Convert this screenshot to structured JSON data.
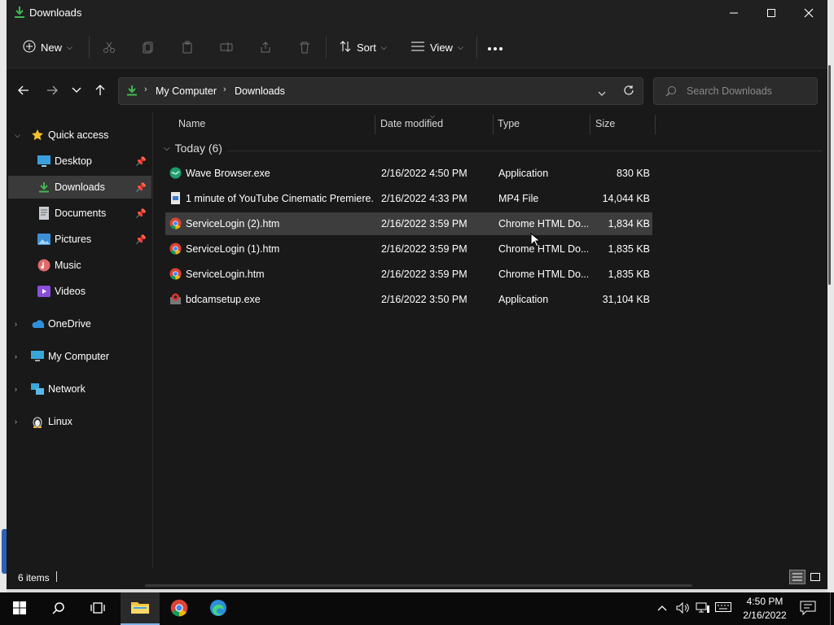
{
  "window": {
    "title": "Downloads"
  },
  "toolbar": {
    "new_label": "New",
    "sort_label": "Sort",
    "view_label": "View"
  },
  "address": {
    "crumbs": [
      "My Computer",
      "Downloads"
    ],
    "search_placeholder": "Search Downloads"
  },
  "nav": {
    "quick_access": "Quick access",
    "pinned": [
      {
        "label": "Desktop",
        "icon": "desktop-icon"
      },
      {
        "label": "Downloads",
        "icon": "downloads-icon"
      },
      {
        "label": "Documents",
        "icon": "documents-icon"
      },
      {
        "label": "Pictures",
        "icon": "pictures-icon"
      }
    ],
    "other": [
      {
        "label": "Music",
        "icon": "music-icon"
      },
      {
        "label": "Videos",
        "icon": "videos-icon"
      }
    ],
    "roots": [
      {
        "label": "OneDrive",
        "icon": "cloud-icon"
      },
      {
        "label": "My Computer",
        "icon": "computer-icon"
      },
      {
        "label": "Network",
        "icon": "network-icon"
      },
      {
        "label": "Linux",
        "icon": "linux-icon"
      }
    ]
  },
  "columns": {
    "name": "Name",
    "date": "Date modified",
    "type": "Type",
    "size": "Size"
  },
  "group": {
    "label": "Today (6)"
  },
  "files": [
    {
      "name": "Wave Browser.exe",
      "date": "2/16/2022 4:50 PM",
      "type": "Application",
      "size": "830 KB",
      "icon": "wave-browser-icon"
    },
    {
      "name": "1 minute of YouTube Cinematic Premiere...",
      "date": "2/16/2022 4:33 PM",
      "type": "MP4 File",
      "size": "14,044 KB",
      "icon": "video-file-icon"
    },
    {
      "name": "ServiceLogin (2).htm",
      "date": "2/16/2022 3:59 PM",
      "type": "Chrome HTML Do...",
      "size": "1,834 KB",
      "icon": "chrome-icon"
    },
    {
      "name": "ServiceLogin (1).htm",
      "date": "2/16/2022 3:59 PM",
      "type": "Chrome HTML Do...",
      "size": "1,835 KB",
      "icon": "chrome-icon"
    },
    {
      "name": "ServiceLogin.htm",
      "date": "2/16/2022 3:59 PM",
      "type": "Chrome HTML Do...",
      "size": "1,835 KB",
      "icon": "chrome-icon"
    },
    {
      "name": "bdcamsetup.exe",
      "date": "2/16/2022 3:50 PM",
      "type": "Application",
      "size": "31,104 KB",
      "icon": "installer-icon"
    }
  ],
  "selected_row": 2,
  "status": {
    "items": "6 items"
  },
  "taskbar": {
    "time": "4:50 PM",
    "date": "2/16/2022"
  },
  "colors": {
    "window_bg": "#191919",
    "selection": "#3a3a3a",
    "accent_green": "#3fb950",
    "folder_blue": "#4aa3df"
  }
}
